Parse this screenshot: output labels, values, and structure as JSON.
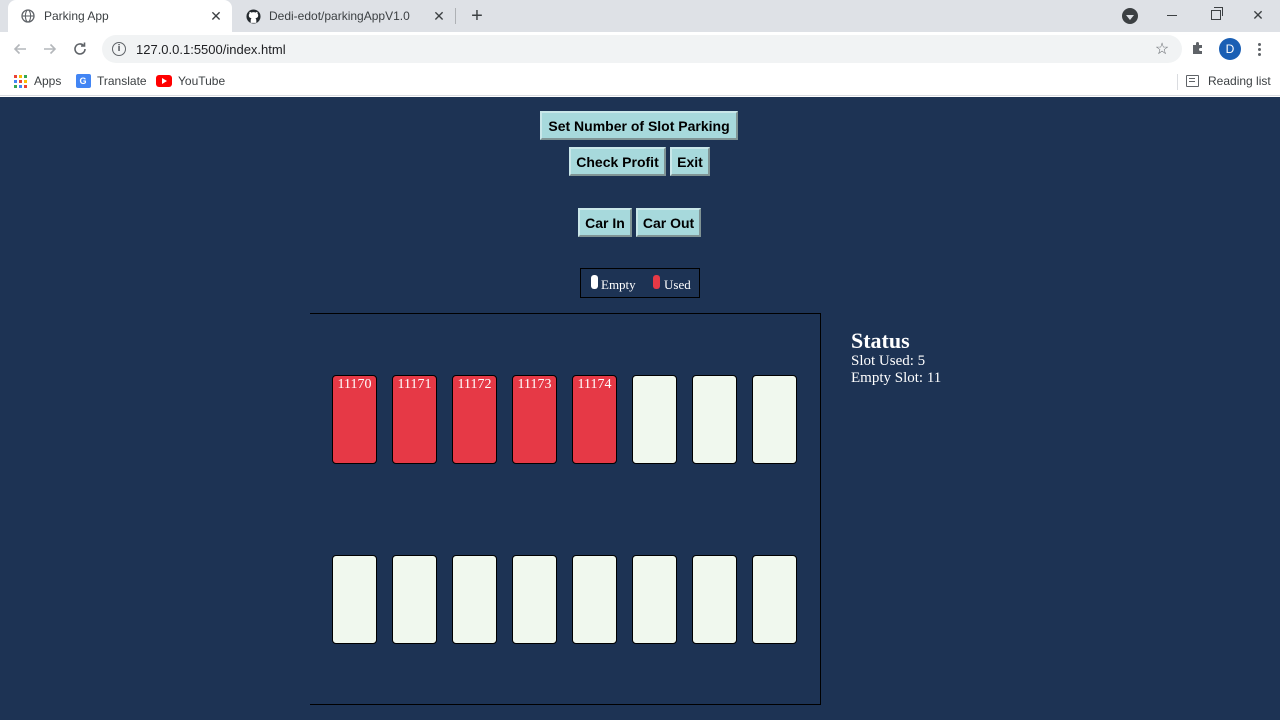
{
  "browser": {
    "tabs": [
      {
        "title": "Parking App",
        "active": true,
        "icon": "globe-icon"
      },
      {
        "title": "Dedi-edot/parkingAppV1.0",
        "active": false,
        "icon": "github-icon"
      }
    ],
    "url": "127.0.0.1:5500/index.html",
    "profile_initial": "D",
    "bookmarks": [
      {
        "label": "Apps",
        "icon": "apps-grid-icon"
      },
      {
        "label": "Translate",
        "icon": "translate-icon"
      },
      {
        "label": "YouTube",
        "icon": "youtube-icon"
      }
    ],
    "reading_list": "Reading list"
  },
  "controls": {
    "set_slots": "Set Number of Slot Parking",
    "check_profit": "Check Profit",
    "exit": "Exit",
    "car_in": "Car In",
    "car_out": "Car Out"
  },
  "legend": {
    "empty": "Empty",
    "used": "Used"
  },
  "colors": {
    "page_bg": "#1d3354",
    "button_bg": "#a7d9dc",
    "slot_used": "#e63946",
    "slot_empty": "#f0f8ee"
  },
  "parking": {
    "slots": [
      {
        "label": "11170",
        "used": true
      },
      {
        "label": "11171",
        "used": true
      },
      {
        "label": "11172",
        "used": true
      },
      {
        "label": "11173",
        "used": true
      },
      {
        "label": "11174",
        "used": true
      },
      {
        "label": "",
        "used": false
      },
      {
        "label": "",
        "used": false
      },
      {
        "label": "",
        "used": false
      },
      {
        "label": "",
        "used": false
      },
      {
        "label": "",
        "used": false
      },
      {
        "label": "",
        "used": false
      },
      {
        "label": "",
        "used": false
      },
      {
        "label": "",
        "used": false
      },
      {
        "label": "",
        "used": false
      },
      {
        "label": "",
        "used": false
      },
      {
        "label": "",
        "used": false
      }
    ]
  },
  "status": {
    "title": "Status",
    "slot_used": "Slot Used: 5",
    "empty_slot": "Empty Slot: 11"
  }
}
